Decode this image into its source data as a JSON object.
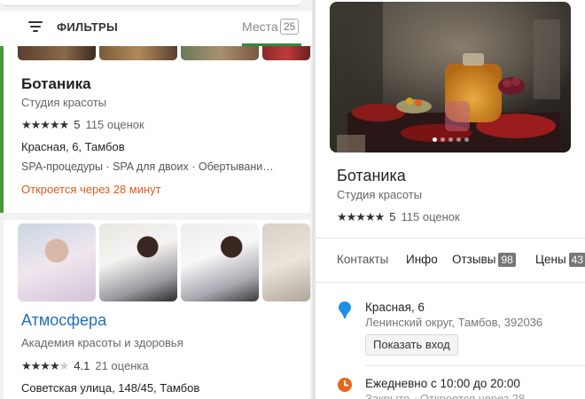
{
  "filter_bar": {
    "filters_label": "ФИЛЬТРЫ",
    "places_label": "Места",
    "places_count": "25"
  },
  "results": [
    {
      "name": "Ботаника",
      "category": "Студия красоты",
      "stars": "★★★★★",
      "rating": "5",
      "reviews": "115 оценок",
      "address": "Красная, 6, Тамбов",
      "services": "SPA-процедуры · SPA для двоих · Обертывани…",
      "open_status": "Откроется через 28 минут"
    },
    {
      "name": "Атмосфера",
      "category": "Академия красоты и здоровья",
      "stars_filled": "★★★★",
      "stars_empty": "★",
      "rating": "4.1",
      "reviews": "21 оценка",
      "address": "Советская улица, 148/45, Тамбов"
    }
  ],
  "detail": {
    "name": "Ботаника",
    "category": "Студия красоты",
    "stars": "★★★★★",
    "rating": "5",
    "reviews": "115 оценок",
    "tabs": [
      {
        "label": "Контакты"
      },
      {
        "label": "Инфо"
      },
      {
        "label": "Отзывы",
        "badge": "98"
      },
      {
        "label": "Цены",
        "badge": "43"
      }
    ],
    "address_line": "Красная, 6",
    "address_detail": "Ленинский округ, Тамбов, 392036",
    "show_entrance": "Показать вход",
    "hours": "Ежедневно с 10:00 до 20:00",
    "hours_status": "Закрыто · Откроется через 28"
  },
  "colors": {
    "accent_green": "#2e8b3a",
    "open_orange": "#e05a1a",
    "link_blue": "#1f6fb8"
  }
}
